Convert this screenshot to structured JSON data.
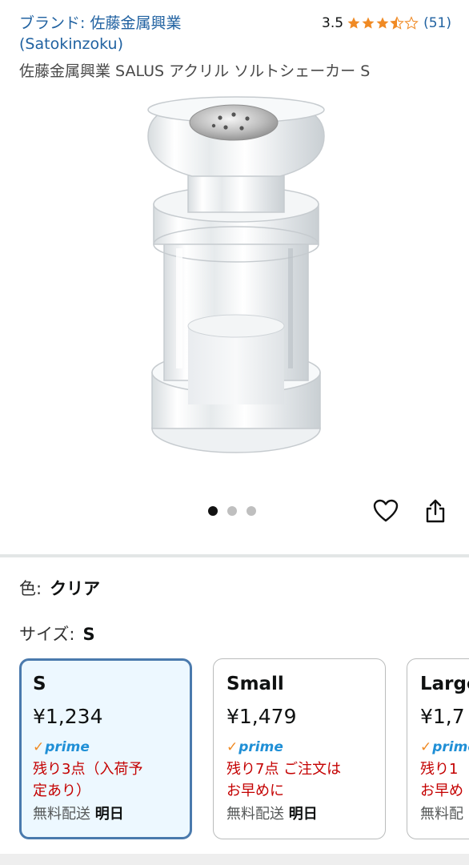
{
  "header": {
    "brand_line1": "ブランド: 佐藤金属興業",
    "brand_line2": "(Satokinzoku)",
    "rating_value": "3.5",
    "rating_stars": 3.5,
    "rating_count": "(51)",
    "product_title": "佐藤金属興業 SALUS アクリル ソルトシェーカー S"
  },
  "gallery": {
    "image_alt": "salt shaker product image",
    "dot_count": 3,
    "active_dot": 1
  },
  "icons": {
    "heart": "heart-icon",
    "share": "share-icon"
  },
  "variations": {
    "color_label": "色:",
    "color_value": "クリア",
    "size_label": "サイズ:",
    "size_value": "S"
  },
  "size_options": [
    {
      "name": "S",
      "price": "¥1,234",
      "prime": "prime",
      "stock": "残り3点（入荷予\n定あり）",
      "delivery_prefix": "無料配送",
      "delivery_day": "明日",
      "selected": true
    },
    {
      "name": "Small",
      "price": "¥1,479",
      "prime": "prime",
      "stock": "残り7点 ご注文は\nお早めに",
      "delivery_prefix": "無料配送",
      "delivery_day": "明日",
      "selected": false
    },
    {
      "name": "Large",
      "price": "¥1,7",
      "prime": "prime",
      "stock": "残り1\nお早め",
      "delivery_prefix": "無料配",
      "delivery_day": "",
      "selected": false
    }
  ],
  "colors": {
    "link": "#2162a1",
    "star": "#f08a24",
    "prime_blue": "#1f8fd6",
    "stock_red": "#c40000",
    "selected_border": "#4a7aad",
    "selected_bg": "#edf8ff"
  }
}
